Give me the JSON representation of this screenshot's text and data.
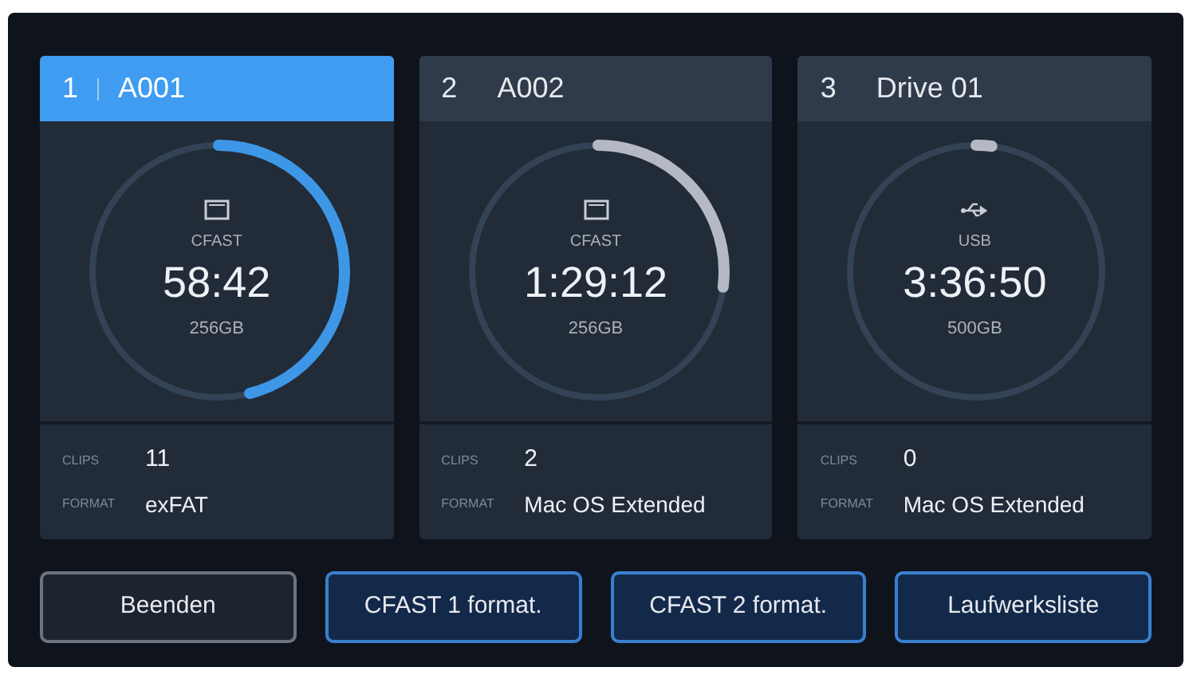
{
  "slots": [
    {
      "number": "1",
      "name": "A001",
      "selected": true,
      "kind": "card",
      "media": "CFAST",
      "time": "58:42",
      "capacity": "256GB",
      "level": 0.46,
      "clips_label": "CLIPS",
      "clips": "11",
      "format_label": "FORMAT",
      "format": "exFAT"
    },
    {
      "number": "2",
      "name": "A002",
      "selected": false,
      "kind": "card",
      "media": "CFAST",
      "time": "1:29:12",
      "capacity": "256GB",
      "level": 0.27,
      "clips_label": "CLIPS",
      "clips": "2",
      "format_label": "FORMAT",
      "format": "Mac OS Extended"
    },
    {
      "number": "3",
      "name": "Drive 01",
      "selected": false,
      "kind": "usb",
      "media": "USB",
      "time": "3:36:50",
      "capacity": "500GB",
      "level": 0.02,
      "clips_label": "CLIPS",
      "clips": "0",
      "format_label": "FORMAT",
      "format": "Mac OS Extended"
    }
  ],
  "buttons": [
    {
      "label": "Beenden",
      "highlighted": false
    },
    {
      "label": "CFAST 1 format.",
      "highlighted": true
    },
    {
      "label": "CFAST 2 format.",
      "highlighted": true
    },
    {
      "label": "Laufwerksliste",
      "highlighted": true
    }
  ]
}
